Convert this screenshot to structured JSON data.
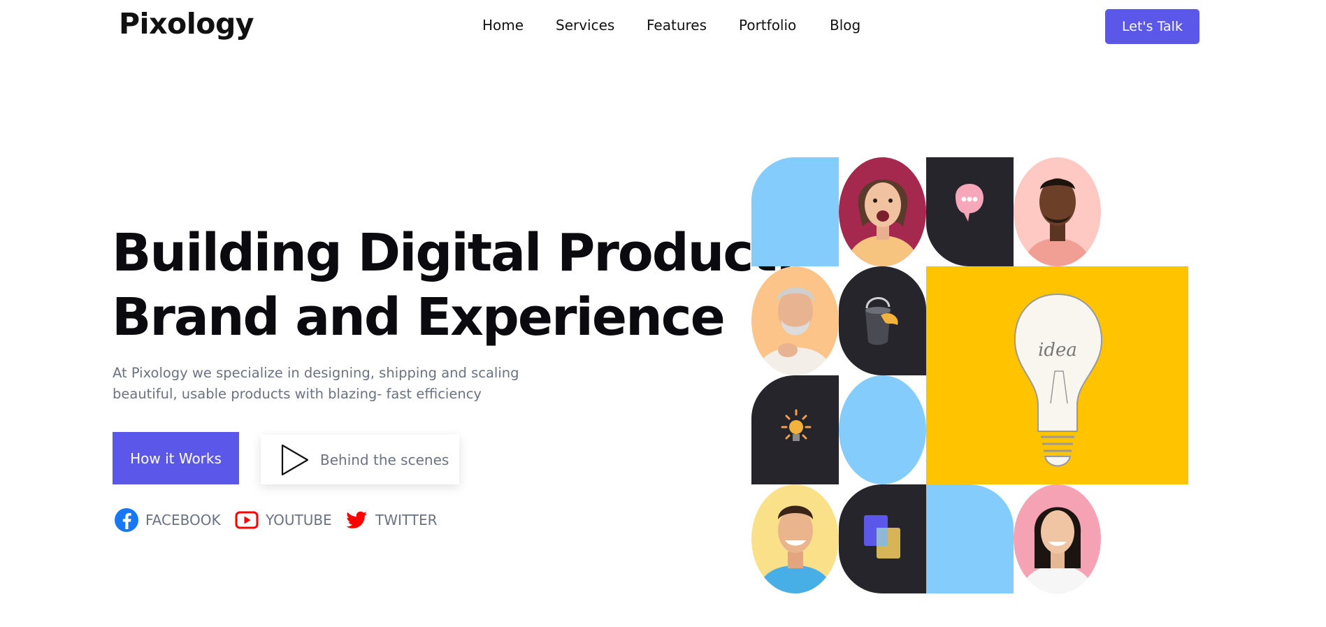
{
  "brand": {
    "name": "Pixology"
  },
  "nav": {
    "items": [
      {
        "label": "Home"
      },
      {
        "label": "Services"
      },
      {
        "label": "Features"
      },
      {
        "label": "Portfolio"
      },
      {
        "label": "Blog"
      }
    ],
    "cta_label": "Let's Talk"
  },
  "hero": {
    "title_line1": "Building Digital Product,",
    "title_line2": "Brand and Experience",
    "subtitle_line1": "At Pixology we specialize in designing, shipping and scaling",
    "subtitle_line2": "beautiful, usable products with blazing- fast efficiency",
    "primary_button": "How it Works",
    "video_button": "Behind the scenes"
  },
  "social": [
    {
      "label": "FACEBOOK",
      "icon": "facebook-icon"
    },
    {
      "label": "YOUTUBE",
      "icon": "youtube-icon"
    },
    {
      "label": "TWITTER",
      "icon": "twitter-icon"
    }
  ],
  "colors": {
    "accent": "#5b57e8",
    "tile_blue": "#84ccfc",
    "tile_dark": "#25252b",
    "tile_yellow": "#ffc300",
    "facebook": "#1877f2",
    "youtube": "#ff0000",
    "twitter": "#ff0000"
  },
  "illustration": {
    "bulb_text": "idea"
  }
}
